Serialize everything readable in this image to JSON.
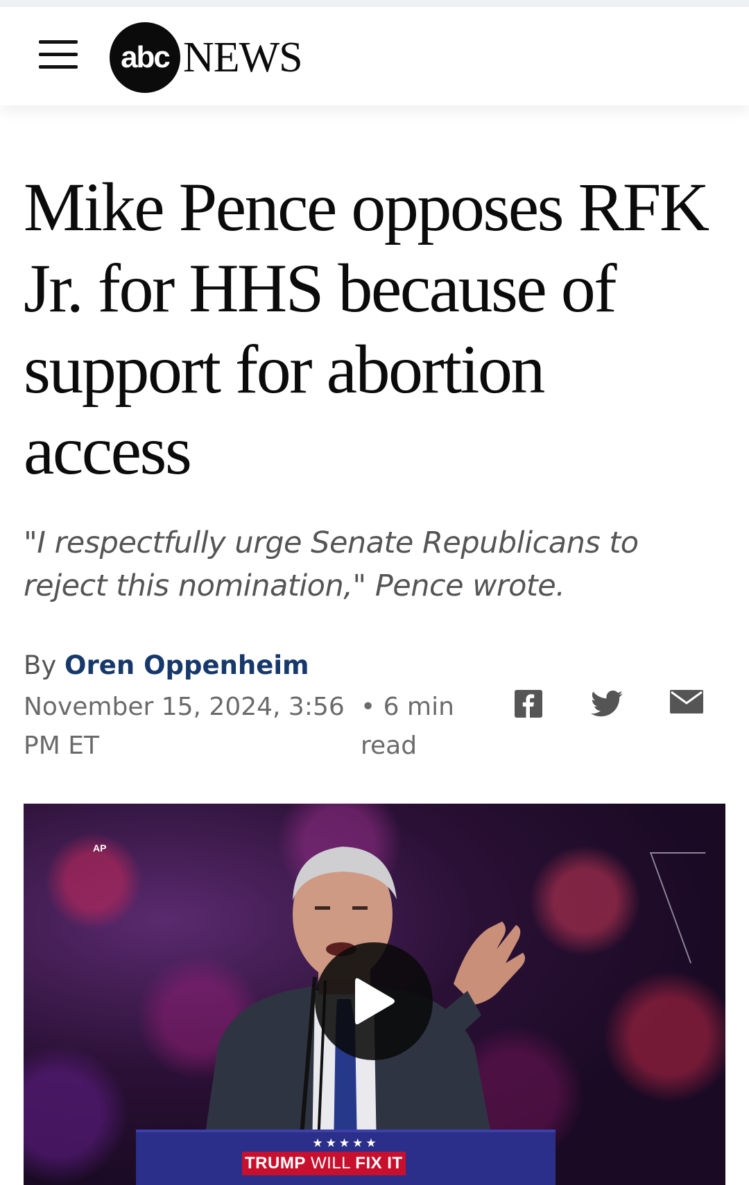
{
  "header": {
    "logo_abc": "abc",
    "logo_news": "NEWS",
    "menu_icon": "hamburger-menu-icon"
  },
  "article": {
    "headline": "Mike Pence opposes RFK Jr. for HHS because of support for abortion access",
    "dek": "\"I respectfully urge Senate Republicans to reject this nomination,\" Pence wrote.",
    "byline_prefix": "By",
    "author": "Oren Oppenheim",
    "timestamp": "November 15, 2024, 3:56 PM ET",
    "read_time": "• 6 min read"
  },
  "share": {
    "icons": [
      "facebook-icon",
      "twitter-icon",
      "email-icon"
    ],
    "icon_color": "#555555"
  },
  "media": {
    "credit": "AP",
    "play_icon": "play-icon",
    "podium_stars": "★★★★★",
    "podium_sign": "TRUMP WILL FIX IT",
    "podium_sign_word1": "TRUMP",
    "podium_sign_word2": "WILL",
    "podium_sign_word3": "FIX IT",
    "podium_name": "TRUMP"
  },
  "colors": {
    "author_link": "#17386b",
    "headline": "#0b0b0b",
    "dek": "#555555"
  }
}
